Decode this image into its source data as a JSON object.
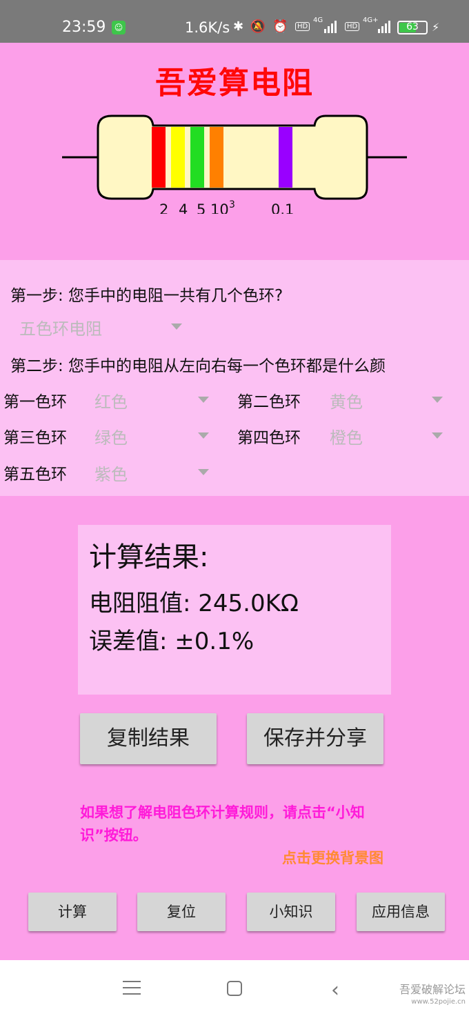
{
  "status_bar": {
    "time": "23:59",
    "speed": "1.6K/s",
    "net1": "4G",
    "net2": "4G+",
    "hd": "HD",
    "battery": "63"
  },
  "app": {
    "title": "吾爱算电阻"
  },
  "resistor": {
    "band_colors": [
      "#ff0000",
      "#ffff00",
      "#22dd22",
      "#ff8000",
      "#9900ff"
    ],
    "band_labels": [
      "2",
      "4",
      "5",
      "10",
      "3",
      "0.1"
    ],
    "body_color": "#fff7c4"
  },
  "step1": {
    "question": "第一步: 您手中的电阻一共有几个色环?",
    "selected": "五色环电阻"
  },
  "step2": {
    "question": "第二步: 您手中的电阻从左向右每一个色环都是什么颜",
    "rings": [
      {
        "label": "第一色环",
        "value": "红色"
      },
      {
        "label": "第二色环",
        "value": "黄色"
      },
      {
        "label": "第三色环",
        "value": "绿色"
      },
      {
        "label": "第四色环",
        "value": "橙色"
      },
      {
        "label": "第五色环",
        "value": "紫色"
      }
    ]
  },
  "result": {
    "heading": "计算结果:",
    "resistance": "电阻阻值: 245.0KΩ",
    "tolerance": "误差值: ±0.1%"
  },
  "actions": {
    "copy": "复制结果",
    "save_share": "保存并分享"
  },
  "hint": "如果想了解电阻色环计算规则，请点击“小知识”按钮。",
  "change_background": "点击更换背景图",
  "bottom_buttons": [
    "计算",
    "复位",
    "小知识",
    "应用信息"
  ],
  "watermark": {
    "text": "吾爱破解论坛",
    "url": "www.52pojie.cn"
  }
}
